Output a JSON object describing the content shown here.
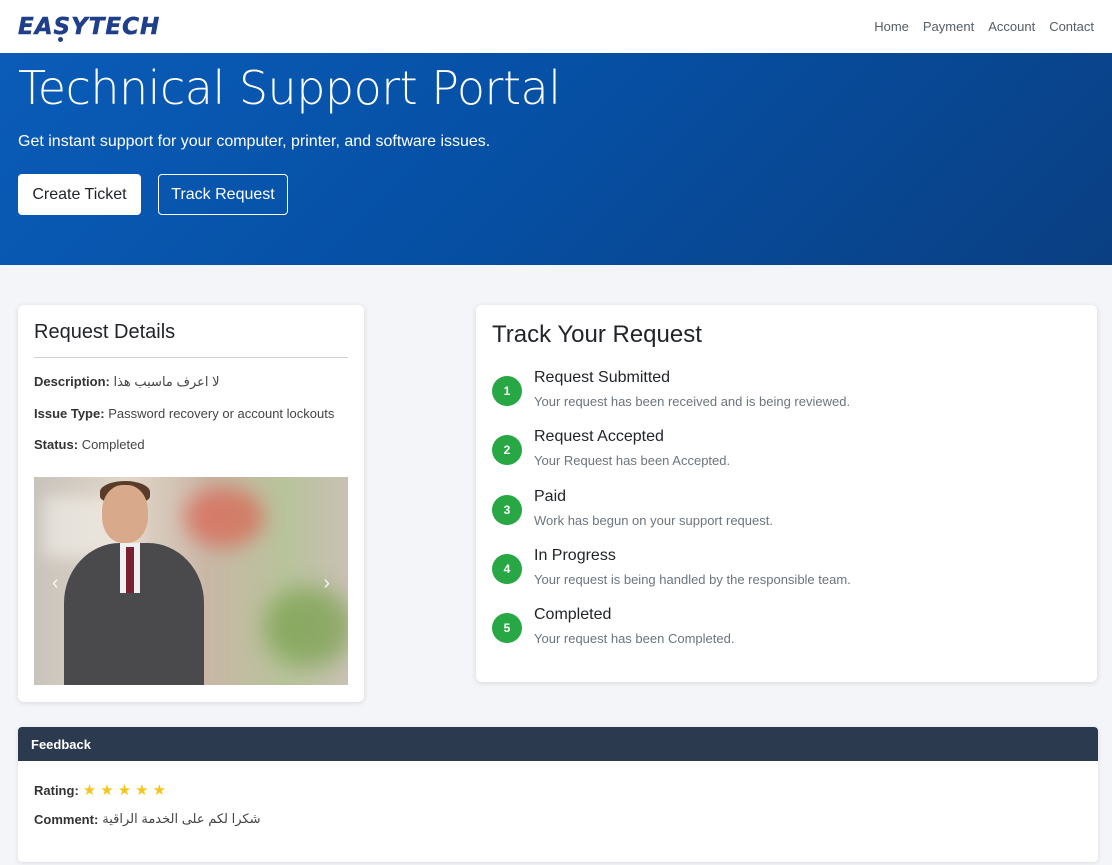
{
  "brand": {
    "logo_text": "EASYTECH"
  },
  "nav": {
    "items": [
      "Home",
      "Payment",
      "Account",
      "Contact"
    ]
  },
  "hero": {
    "title": "Technical Support Portal",
    "subtitle": "Get instant support for your computer, printer, and software issues.",
    "create_label": "Create Ticket",
    "track_label": "Track Request"
  },
  "details": {
    "title": "Request Details",
    "description_label": "Description:",
    "description_value": "لا اعرف ماسبب هذا",
    "issue_label": "Issue Type:",
    "issue_value": "Password recovery or account lockouts",
    "status_label": "Status:",
    "status_value": "Completed",
    "prev_icon": "‹",
    "next_icon": "›"
  },
  "track": {
    "title": "Track Your Request",
    "steps": [
      {
        "num": "1",
        "title": "Request Submitted",
        "desc": "Your request has been received and is being reviewed."
      },
      {
        "num": "2",
        "title": "Request Accepted",
        "desc": "Your Request has been Accepted."
      },
      {
        "num": "3",
        "title": "Paid",
        "desc": "Work has begun on your support request."
      },
      {
        "num": "4",
        "title": "In Progress",
        "desc": "Your request is being handled by the responsible team."
      },
      {
        "num": "5",
        "title": "Completed",
        "desc": "Your request has been Completed."
      }
    ],
    "step_color": "#28a745"
  },
  "feedback": {
    "header": "Feedback",
    "rating_label": "Rating:",
    "rating_value": 5,
    "rating_max": 5,
    "star_glyph": "★",
    "comment_label": "Comment:",
    "comment_value": "شكرا لكم على الخدمة الراقية"
  },
  "colors": {
    "hero_bg": "#0650a5",
    "feedback_header_bg": "#2c3a4f",
    "star": "#f5c518"
  }
}
